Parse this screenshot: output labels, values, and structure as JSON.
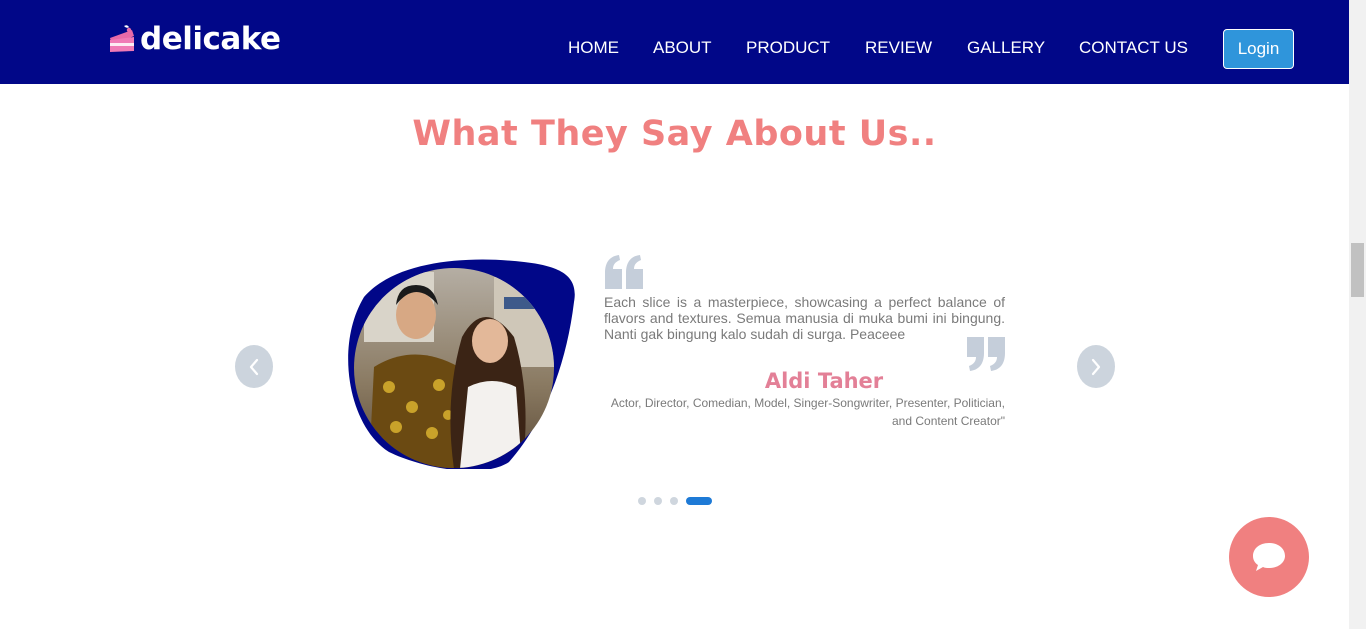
{
  "brand": {
    "name": "delicake",
    "logo_icon": "cake-slice-icon"
  },
  "nav": {
    "items": [
      {
        "label": "HOME"
      },
      {
        "label": "ABOUT"
      },
      {
        "label": "PRODUCT"
      },
      {
        "label": "REVIEW"
      },
      {
        "label": "GALLERY"
      },
      {
        "label": "CONTACT US"
      }
    ],
    "login_label": "Login"
  },
  "testimonials": {
    "title": "What They Say About Us..",
    "active_slide": {
      "review": "Each slice is a masterpiece, showcasing a perfect balance of flavors and textures. Semua manusia di muka bumi ini bingung. Nanti gak bingung kalo sudah di surga. Peaceee",
      "name": "Aldi Taher",
      "role": "Actor, Director, Comedian, Model, Singer-Songwriter, Presenter, Politician, and Content Creator\""
    },
    "slide_count": 4,
    "active_index": 4,
    "prev_icon": "chevron-left-icon",
    "next_icon": "chevron-right-icon"
  },
  "chat": {
    "icon": "chat-bubble-icon"
  },
  "colors": {
    "navbar": "#010788",
    "accent_pink": "#f08080",
    "name_pink": "#e38097",
    "login_blue": "#2f95db",
    "indicator_active": "#1e7ad6"
  }
}
